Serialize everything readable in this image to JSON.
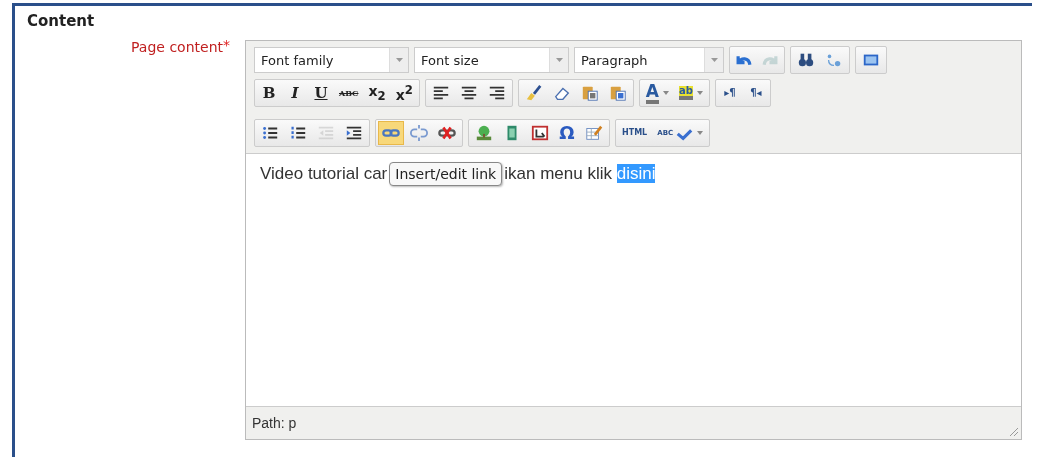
{
  "section": {
    "title": "Content"
  },
  "field": {
    "label": "Page content",
    "required_mark": "*"
  },
  "editor": {
    "toolbar_rows": [
      {
        "selects": [
          {
            "value": "Font family"
          },
          {
            "value": "Font size"
          },
          {
            "value": "Paragraph"
          }
        ],
        "groups": [
          [
            {
              "kind": "undo",
              "active": false,
              "disabled": false
            },
            {
              "kind": "redo",
              "active": false,
              "disabled": true
            }
          ],
          [
            {
              "kind": "find",
              "active": false,
              "disabled": false
            },
            {
              "kind": "replace",
              "active": false,
              "disabled": false
            }
          ],
          [
            {
              "kind": "fullscreen",
              "active": false,
              "disabled": false
            }
          ]
        ]
      },
      {
        "groups": [
          [
            {
              "kind": "bold",
              "label": "B",
              "active": false,
              "disabled": false
            },
            {
              "kind": "italic",
              "label": "I",
              "active": false,
              "disabled": false
            },
            {
              "kind": "underline",
              "label": "U",
              "active": false,
              "disabled": false
            },
            {
              "kind": "strike",
              "label": "ABC",
              "active": false,
              "disabled": false
            },
            {
              "kind": "sub",
              "label": "x$_{2}$",
              "active": false,
              "disabled": false
            },
            {
              "kind": "sup",
              "label": "x$^{2}$",
              "active": false,
              "disabled": false
            }
          ],
          [
            {
              "kind": "alignleft",
              "active": false,
              "disabled": false
            },
            {
              "kind": "aligncenter",
              "active": false,
              "disabled": false
            },
            {
              "kind": "alignright",
              "active": false,
              "disabled": false
            }
          ],
          [
            {
              "kind": "cleanup",
              "active": false,
              "disabled": false
            },
            {
              "kind": "eraser",
              "active": false,
              "disabled": false
            },
            {
              "kind": "pastetext",
              "active": false,
              "disabled": false
            },
            {
              "kind": "pasteword",
              "active": false,
              "disabled": false
            }
          ],
          [
            {
              "kind": "forecolor",
              "label": "A",
              "split": true,
              "active": false,
              "disabled": false
            },
            {
              "kind": "backcolor",
              "label": "ab",
              "split": true,
              "active": false,
              "disabled": false
            }
          ],
          [
            {
              "kind": "ltr",
              "label": "▸¶",
              "active": false,
              "disabled": false
            },
            {
              "kind": "rtl",
              "label": "¶◂",
              "active": false,
              "disabled": false
            }
          ]
        ]
      },
      {
        "groups": [
          [
            {
              "kind": "bullist",
              "active": false,
              "disabled": false
            },
            {
              "kind": "numlist",
              "active": false,
              "disabled": false
            },
            {
              "kind": "outdent",
              "active": false,
              "disabled": true
            },
            {
              "kind": "indent",
              "active": false,
              "disabled": false
            }
          ],
          [
            {
              "kind": "link",
              "active": true,
              "disabled": false
            },
            {
              "kind": "unlink",
              "active": false,
              "disabled": false
            },
            {
              "kind": "anchor",
              "active": false,
              "disabled": false
            }
          ],
          [
            {
              "kind": "image",
              "active": false,
              "disabled": false
            },
            {
              "kind": "media",
              "active": false,
              "disabled": false
            },
            {
              "kind": "nonbreaking",
              "active": false,
              "disabled": false
            },
            {
              "kind": "charmap",
              "label": "Ω",
              "active": false,
              "disabled": false
            },
            {
              "kind": "tableedit",
              "active": false,
              "disabled": false
            }
          ],
          [
            {
              "kind": "html",
              "label": "HTML",
              "active": false,
              "disabled": false
            },
            {
              "kind": "spell",
              "label": "ABC",
              "split": true,
              "active": false,
              "disabled": false
            }
          ]
        ]
      }
    ],
    "content": [
      {
        "kind": "text",
        "text": "Video tutorial car",
        "selected": false
      },
      {
        "kind": "tooltip",
        "text": "Insert/edit link"
      },
      {
        "kind": "text",
        "text": "ikan menu klik ",
        "selected": false
      },
      {
        "kind": "text",
        "text": "disini",
        "selected": true
      }
    ],
    "path": "Path: p"
  }
}
